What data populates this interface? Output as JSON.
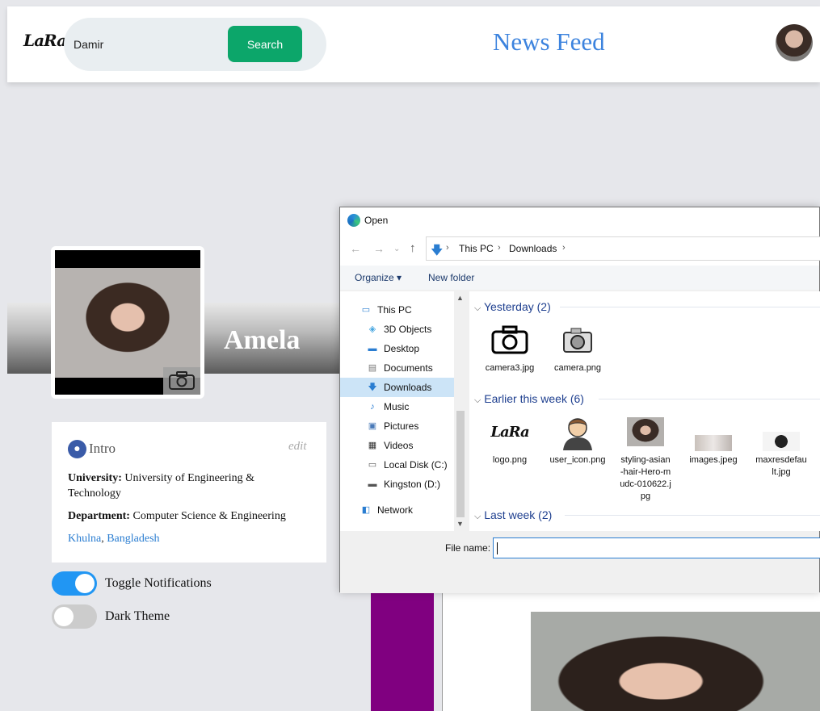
{
  "navbar": {
    "logo_text": "LaRa",
    "search_value": "Damir",
    "search_button": "Search",
    "title": "News Feed"
  },
  "profile": {
    "name": "Amela"
  },
  "intro": {
    "title": "Intro",
    "edit_label": "edit",
    "university_label": "University:",
    "university_value": "University of Engineering & Technology",
    "department_label": "Department:",
    "department_value": "Computer Science & Engineering",
    "city": "Khulna",
    "separator": ",",
    "country": "Bangladesh"
  },
  "toggles": [
    {
      "label": "Toggle Notifications",
      "on": true
    },
    {
      "label": "Dark Theme",
      "on": false
    }
  ],
  "dialog": {
    "title": "Open",
    "breadcrumb": [
      "This PC",
      "Downloads"
    ],
    "toolbar": {
      "organize": "Organize ▾",
      "new_folder": "New folder"
    },
    "nav_items": [
      {
        "label": "This PC",
        "icon": "this-pc-icon"
      },
      {
        "label": "3D Objects",
        "icon": "3d-objects-icon"
      },
      {
        "label": "Desktop",
        "icon": "desktop-icon"
      },
      {
        "label": "Documents",
        "icon": "documents-icon"
      },
      {
        "label": "Downloads",
        "icon": "downloads-icon",
        "selected": true
      },
      {
        "label": "Music",
        "icon": "music-icon"
      },
      {
        "label": "Pictures",
        "icon": "pictures-icon"
      },
      {
        "label": "Videos",
        "icon": "videos-icon"
      },
      {
        "label": "Local Disk (C:)",
        "icon": "local-disk-icon"
      },
      {
        "label": "Kingston (D:)",
        "icon": "usb-drive-icon"
      },
      {
        "label": "Network",
        "icon": "network-icon"
      }
    ],
    "groups": {
      "yesterday": "Yesterday (2)",
      "earlier": "Earlier this week (6)",
      "last_week": "Last week (2)"
    },
    "files": {
      "camera3": "camera3.jpg",
      "camera": "camera.png",
      "logo": "logo.png",
      "user_icon": "user_icon.png",
      "styling": "styling-asian-hair-Hero-mudc-010622.jpg",
      "images": "images.jpeg",
      "maxres": "maxresdefault.jpg"
    },
    "filename_label": "File name:",
    "filename_value": ""
  }
}
